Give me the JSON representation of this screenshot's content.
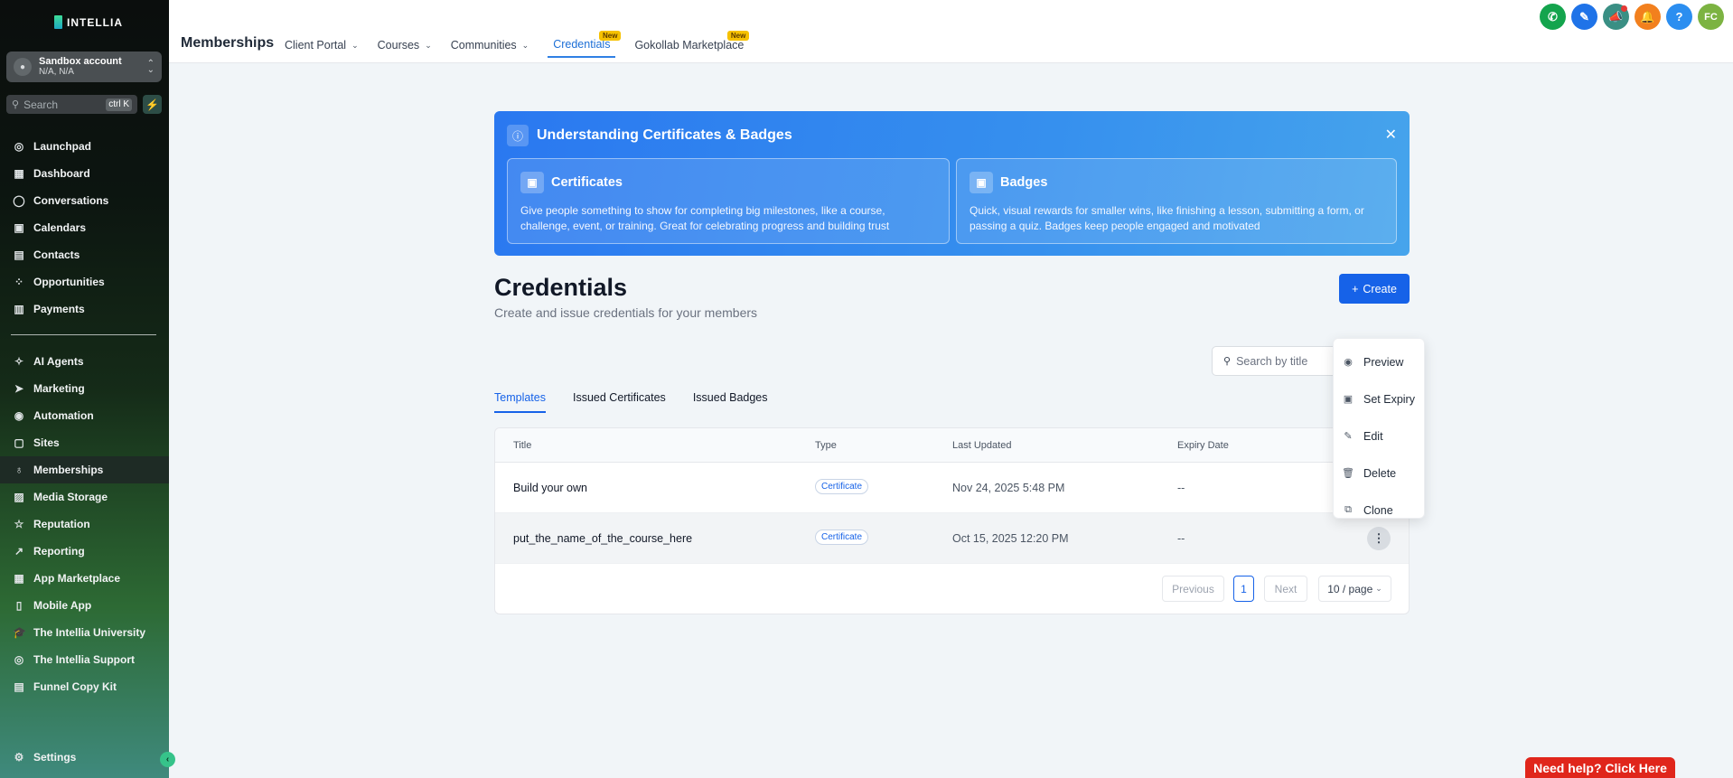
{
  "sidebar": {
    "logo": "INTELLIA",
    "account": {
      "name": "Sandbox account",
      "sub": "N/A, N/A"
    },
    "search": {
      "placeholder": "Search",
      "shortcut": "ctrl K"
    },
    "items_top": [
      {
        "label": "Launchpad",
        "icon": "launchpad-icon",
        "glyph": "◎"
      },
      {
        "label": "Dashboard",
        "icon": "dashboard-icon",
        "glyph": "▦"
      },
      {
        "label": "Conversations",
        "icon": "chat-icon",
        "glyph": "◯"
      },
      {
        "label": "Calendars",
        "icon": "calendar-icon",
        "glyph": "▣"
      },
      {
        "label": "Contacts",
        "icon": "contacts-icon",
        "glyph": "▤"
      },
      {
        "label": "Opportunities",
        "icon": "opportunities-icon",
        "glyph": "⁘"
      },
      {
        "label": "Payments",
        "icon": "payments-icon",
        "glyph": "▥"
      }
    ],
    "items_bottom": [
      {
        "label": "AI Agents",
        "icon": "ai-agents-icon",
        "glyph": "✧"
      },
      {
        "label": "Marketing",
        "icon": "marketing-icon",
        "glyph": "➤"
      },
      {
        "label": "Automation",
        "icon": "automation-icon",
        "glyph": "◉"
      },
      {
        "label": "Sites",
        "icon": "sites-icon",
        "glyph": "▢"
      },
      {
        "label": "Memberships",
        "icon": "memberships-icon",
        "glyph": "♁",
        "active": true
      },
      {
        "label": "Media Storage",
        "icon": "media-icon",
        "glyph": "▨"
      },
      {
        "label": "Reputation",
        "icon": "star-icon",
        "glyph": "☆"
      },
      {
        "label": "Reporting",
        "icon": "reporting-icon",
        "glyph": "↗"
      },
      {
        "label": "App Marketplace",
        "icon": "marketplace-icon",
        "glyph": "▦"
      },
      {
        "label": "Mobile App",
        "icon": "mobile-icon",
        "glyph": "▯"
      },
      {
        "label": "The Intellia University",
        "icon": "university-icon",
        "glyph": "🎓"
      },
      {
        "label": "The Intellia Support",
        "icon": "support-icon",
        "glyph": "◎"
      },
      {
        "label": "Funnel Copy Kit",
        "icon": "document-icon",
        "glyph": "▤"
      }
    ],
    "settings": "Settings"
  },
  "topbar": {
    "title": "Memberships",
    "tabs": [
      {
        "label": "Client Portal",
        "dropdown": true
      },
      {
        "label": "Courses",
        "dropdown": true
      },
      {
        "label": "Communities",
        "dropdown": true
      },
      {
        "label": "Credentials",
        "active": true,
        "badge": "New"
      },
      {
        "label": "Gokollab Marketplace",
        "badge": "New"
      }
    ],
    "avatar_initials": "FC",
    "icons": [
      {
        "name": "phone-icon",
        "glyph": "✆",
        "color": "#14a44d"
      },
      {
        "name": "magic-icon",
        "glyph": "✎",
        "color": "#1f73e8"
      },
      {
        "name": "megaphone-icon",
        "glyph": "📣",
        "color": "#3a8f84"
      },
      {
        "name": "bell-icon",
        "glyph": "🔔",
        "color": "#f2801e"
      },
      {
        "name": "help-icon",
        "glyph": "?",
        "color": "#2b8ef0"
      }
    ]
  },
  "banner": {
    "title": "Understanding Certificates & Badges",
    "cards": [
      {
        "title": "Certificates",
        "desc": "Give people something to show for completing big milestones, like a course, challenge, event, or training. Great for celebrating progress and building trust"
      },
      {
        "title": "Badges",
        "desc": "Quick, visual rewards for smaller wins, like finishing a lesson, submitting a form, or passing a quiz. Badges keep people engaged and motivated"
      }
    ]
  },
  "page": {
    "title": "Credentials",
    "subtitle": "Create and issue credentials for your members",
    "create_label": "Create",
    "search_placeholder": "Search by title"
  },
  "tabs": [
    {
      "label": "Templates",
      "active": true
    },
    {
      "label": "Issued Certificates"
    },
    {
      "label": "Issued Badges"
    }
  ],
  "table": {
    "columns": [
      "Title",
      "Type",
      "Last Updated",
      "Expiry Date"
    ],
    "rows": [
      {
        "title": "Build your own",
        "type": "Certificate",
        "updated": "Nov 24, 2025 5:48 PM",
        "expiry": "--"
      },
      {
        "title": "put_the_name_of_the_course_here",
        "type": "Certificate",
        "updated": "Oct 15, 2025 12:20 PM",
        "expiry": "--"
      }
    ],
    "pager": {
      "prev": "Previous",
      "page": "1",
      "next": "Next",
      "size": "10 / page"
    }
  },
  "dropdown": [
    {
      "label": "Preview",
      "icon": "eye-icon",
      "glyph": "◉"
    },
    {
      "label": "Set Expiry",
      "icon": "calendar-clock-icon",
      "glyph": "▣"
    },
    {
      "label": "Edit",
      "icon": "pencil-icon",
      "glyph": "✎"
    },
    {
      "label": "Delete",
      "icon": "trash-icon",
      "glyph": "🗑"
    },
    {
      "label": "Clone",
      "icon": "copy-icon",
      "glyph": "⧉"
    }
  ],
  "help_button": "Need help? Click Here"
}
